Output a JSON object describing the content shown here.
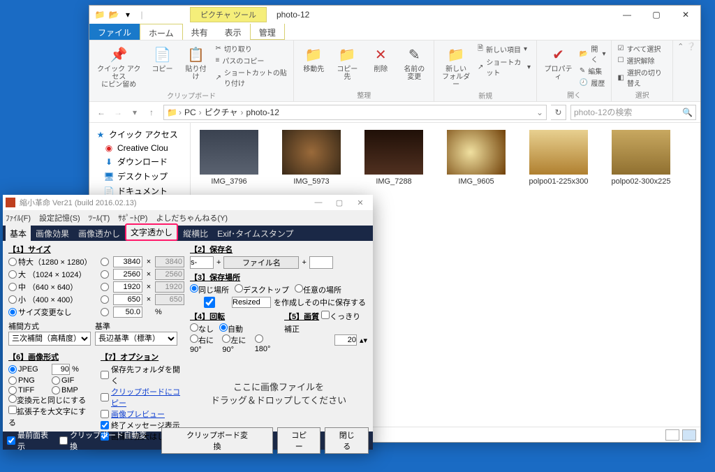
{
  "explorer": {
    "picture_tools_label": "ピクチャ ツール",
    "title": "photo-12",
    "tabs": {
      "file": "ファイル",
      "home": "ホーム",
      "share": "共有",
      "view": "表示",
      "manage": "管理"
    },
    "ribbon": {
      "pin": "クイック アクセス\nにピン留め",
      "copy": "コピー",
      "paste": "貼り付け",
      "cut": "切り取り",
      "copypath": "パスのコピー",
      "pasteshortcut": "ショートカットの貼り付け",
      "clipboard": "クリップボード",
      "moveto": "移動先",
      "copyto": "コピー先",
      "delete": "削除",
      "rename": "名前の\n変更",
      "organize": "整理",
      "newfolder": "新しい\nフォルダー",
      "newitem": "新しい項目",
      "shortcut": "ショートカット",
      "new": "新規",
      "properties": "プロパティ",
      "open_btn": "開く",
      "edit": "編集",
      "history": "履歴",
      "open": "開く",
      "selectall": "すべて選択",
      "selectnone": "選択解除",
      "invert": "選択の切り替え",
      "select": "選択"
    },
    "breadcrumbs": [
      "PC",
      "ピクチャ",
      "photo-12"
    ],
    "search_placeholder": "photo-12の検索",
    "nav": {
      "quick": "クイック アクセス",
      "creative": "Creative Clou",
      "downloads": "ダウンロード",
      "desktop": "デスクトップ",
      "documents": "ドキュメント"
    },
    "files": [
      "IMG_3796",
      "IMG_5973",
      "IMG_7288",
      "IMG_9605",
      "polpo01-225x300",
      "polpo02-300x225"
    ]
  },
  "app": {
    "title": "縮小革命 Ver21 (build 2016.02.13)",
    "menu": [
      "ﾌｧｲﾙ(F)",
      "設定記憶(S)",
      "ﾂｰﾙ(T)",
      "ｻﾎﾟｰﾄ(P)",
      "よしだちゃんねる(Y)"
    ],
    "tabs": [
      "基本",
      "画像効果",
      "画像透かし",
      "文字透かし",
      "縦横比",
      "Exif･タイムスタンプ"
    ],
    "highlight_tab_index": 3,
    "size": {
      "label": "【1】サイズ",
      "rows": [
        {
          "name": "特大（1280 × 1280）",
          "w": "3840",
          "h": "3840"
        },
        {
          "name": "大 （1024 × 1024）",
          "w": "2560",
          "h": "2560"
        },
        {
          "name": "中 （640 × 640）",
          "w": "1920",
          "h": "1920"
        },
        {
          "name": "小 （400 × 400）",
          "w": "650",
          "h": "650"
        }
      ],
      "nochange": "サイズ変更なし",
      "percent": "50.0",
      "percent_suffix": "%",
      "interp_label": "補間方式",
      "interp": "三次補間（高精度）",
      "base_label": "基準",
      "base": "長辺基準（標準）"
    },
    "format": {
      "label": "【6】画像形式",
      "jpeg": "JPEG",
      "jpeg_q": "90",
      "pct": "%",
      "png": "PNG",
      "gif": "GIF",
      "tiff": "TIFF",
      "bmp": "BMP",
      "same": "変換元と同じにする",
      "upperext": "拡張子を大文字にする"
    },
    "options": {
      "label": "【7】オプション",
      "open_folder": "保存先フォルダを開く",
      "clip_copy": "クリップボードにコピー",
      "preview": "画像プレビュー",
      "endmsg": "終了メッセージ表示",
      "noupscale": "画像の拡大はしない"
    },
    "savename": {
      "label": "【2】保存名",
      "prefix": "s-",
      "middle": "ファイル名"
    },
    "saveloc": {
      "label": "【3】保存場所",
      "same": "同じ場所",
      "desktop": "デスクトップ",
      "any": "任意の場所",
      "folder_hint": "を作成しその中に保存する",
      "folder": "Resized"
    },
    "rotate": {
      "label": "【4】回転",
      "none": "なし",
      "auto": "自動",
      "r90": "右に90°",
      "l90": "左に90°",
      "r180": "180°"
    },
    "quality": {
      "label": "【5】画質",
      "sharp": "くっきり補正",
      "value": "20"
    },
    "drop": {
      "l1": "ここに画像ファイルを",
      "l2": "ドラッグ＆ドロップしてください"
    },
    "footer": {
      "topmost": "最前面表示",
      "autoclip": "クリップボード自動変換",
      "clip": "クリップボード変換",
      "copy": "コピー",
      "close": "閉じる"
    }
  }
}
